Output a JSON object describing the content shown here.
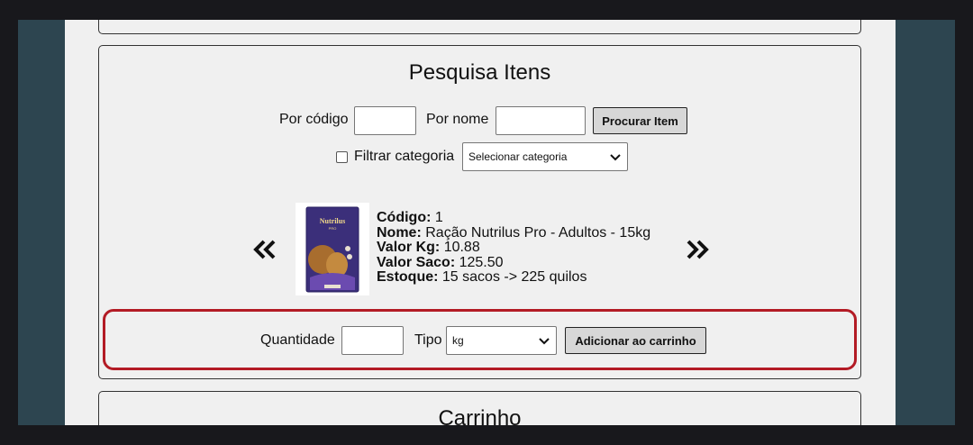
{
  "search": {
    "title": "Pesquisa Itens",
    "by_code_label": "Por código",
    "by_code_value": "",
    "by_name_label": "Por nome",
    "by_name_value": "",
    "search_button": "Procurar Item",
    "filter_category_label": "Filtrar categoria",
    "filter_category_checked": false,
    "category_select_value": "Selecionar categoria"
  },
  "product": {
    "code_label": "Código:",
    "code_value": "1",
    "name_label": "Nome:",
    "name_value": "Ração Nutrilus Pro - Adultos - 15kg",
    "price_kg_label": "Valor Kg:",
    "price_kg_value": "10.88",
    "price_bag_label": "Valor Saco:",
    "price_bag_value": "125.50",
    "stock_label": "Estoque:",
    "stock_value": "15 sacos -> 225 quilos",
    "image_brand": "Nutrilus",
    "image_sub": "PRO"
  },
  "add_to_cart": {
    "quantity_label": "Quantidade",
    "quantity_value": "",
    "type_label": "Tipo",
    "type_select_value": "kg",
    "add_button": "Adicionar ao carrinho"
  },
  "cart": {
    "title": "Carrinho"
  },
  "colors": {
    "page_bg": "#f0f0f0",
    "outer_bg": "#2d4550",
    "highlight_border": "#b31b25",
    "button_bg": "#d7d7d7"
  }
}
